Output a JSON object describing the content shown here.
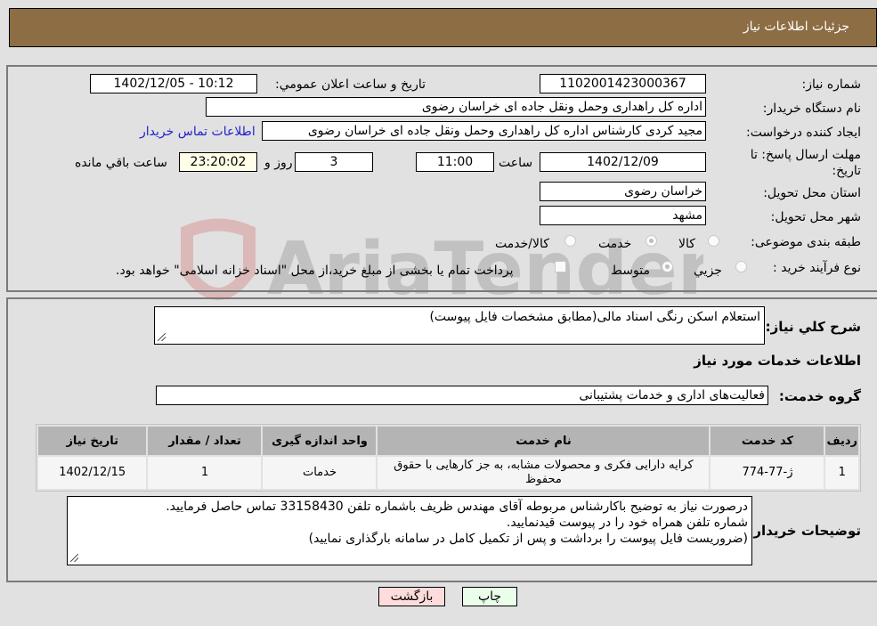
{
  "header": {
    "title": "جزئیات اطلاعات نیاز"
  },
  "fields": {
    "need_number": {
      "label": "شماره نیاز:",
      "value": "1102001423000367"
    },
    "announce_datetime": {
      "label": "تاریخ و ساعت اعلان عمومي:",
      "value": "1402/12/05 - 10:12"
    },
    "buyer_org": {
      "label": "نام دستگاه خریدار:",
      "value": "اداره کل راهداری وحمل ونقل جاده ای خراسان رضوی"
    },
    "requester": {
      "label": "ایجاد کننده درخواست:",
      "value": "مجید کردی کارشناس اداره کل راهداری وحمل ونقل جاده ای خراسان رضوی"
    },
    "buyer_contact_link": "اطلاعات تماس خریدار",
    "deadline": {
      "label": "مهلت ارسال پاسخ: تا تاریخ:",
      "date": "1402/12/09",
      "time_label": "ساعت",
      "time": "11:00",
      "days": "3",
      "days_label": "روز و",
      "remaining": "23:20:02",
      "remaining_label": "ساعت باقي مانده"
    },
    "province": {
      "label": "استان محل تحویل:",
      "value": "خراسان رضوی"
    },
    "city": {
      "label": "شهر محل تحویل:",
      "value": "مشهد"
    },
    "category": {
      "label": "طبقه بندی موضوعی:",
      "options": [
        "کالا",
        "خدمت",
        "کالا/خدمت"
      ],
      "selected": "خدمت"
    },
    "purchase_type": {
      "label": "نوع فرآیند خرید :",
      "options": [
        "جزيي",
        "متوسط"
      ],
      "selected": "متوسط",
      "treasury_note": "پرداخت تمام یا بخشی از مبلغ خرید،از محل \"اسناد خزانه اسلامی\" خواهد بود."
    }
  },
  "description": {
    "label": "شرح کلي نیاز:",
    "value": "استعلام اسکن رنگی اسناد مالی(مطابق مشخصات فایل پیوست)"
  },
  "services_section_title": "اطلاعات خدمات مورد نیاز",
  "service_group": {
    "label": "گروه خدمت:",
    "value": "فعالیت‌های اداری و خدمات پشتیبانی"
  },
  "services_table": {
    "columns": [
      "ردیف",
      "کد خدمت",
      "نام خدمت",
      "واحد اندازه گیری",
      "تعداد / مقدار",
      "تاریخ نیاز"
    ],
    "rows": [
      [
        "1",
        "ژ-77-774",
        "کرایه دارایی فکری و محصولات مشابه، به جز کارهایی با حقوق محفوظ",
        "خدمات",
        "1",
        "1402/12/15"
      ]
    ]
  },
  "buyer_notes": {
    "label": "توضیحات خریدار:",
    "lines": [
      "درصورت نیاز به توضیح باکارشناس مربوطه آقای مهندس ظریف باشماره تلفن 33158430 تماس حاصل فرمایید.",
      "شماره تلفن همراه خود را در پیوست قیدنمایید.",
      "(ضروریست فایل پیوست را برداشت و پس از تکمیل کامل در سامانه بارگذاری نمایید)"
    ]
  },
  "buttons": {
    "print": "چاپ",
    "back": "بازگشت"
  },
  "colors": {
    "header_bg": "#8d6d44",
    "print_bg": "#eaffea",
    "back_bg": "#ffdcdc",
    "remaining_bg": "#ffffe8",
    "link": "#2222cc"
  },
  "watermark_text": "AriaTender.neT"
}
